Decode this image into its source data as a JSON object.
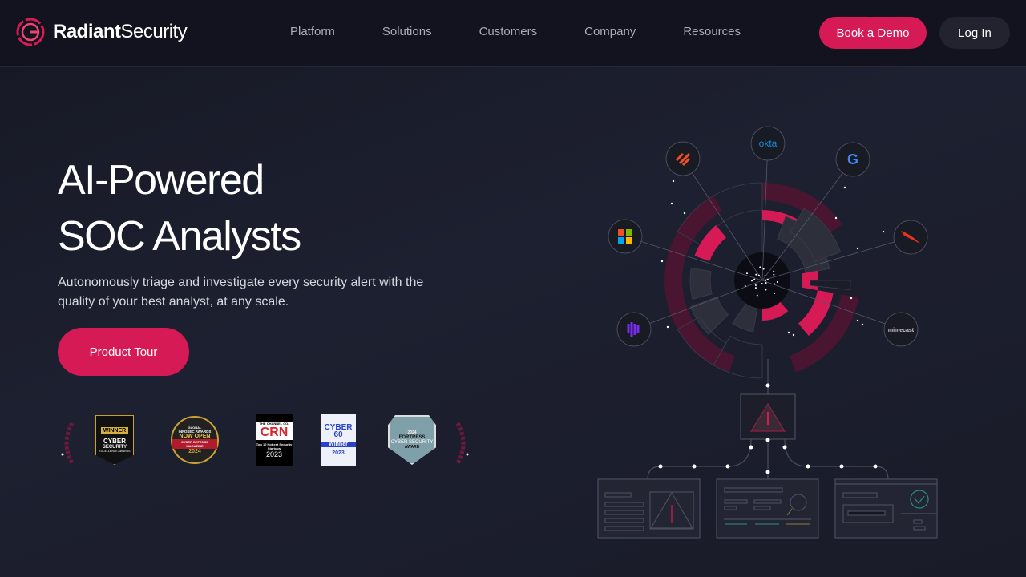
{
  "header": {
    "logo_bold": "Radiant",
    "logo_light": "Security",
    "nav": [
      "Platform",
      "Solutions",
      "Customers",
      "Company",
      "Resources"
    ],
    "book_demo": "Book a Demo",
    "login": "Log In"
  },
  "hero": {
    "title_line1": "AI-Powered",
    "title_line2": "SOC Analysts",
    "subtitle": "Autonomously triage and investigate every security alert with the quality of your best analyst, at any scale.",
    "cta": "Product Tour"
  },
  "awards": [
    {
      "name": "Cyber Security Excellence Awards",
      "lines": [
        "WINNER",
        "CYBER",
        "SECURITY",
        "EXCELLENCE AWARDS"
      ]
    },
    {
      "name": "Global InfoSec Awards",
      "lines": [
        "GLOBAL",
        "INFOSEC AWARDS",
        "NOW OPEN",
        "CYBER DEFENSE MAGAZINE",
        "2024"
      ]
    },
    {
      "name": "CRN",
      "lines": [
        "THE CHANNEL CO.",
        "CRN",
        "Top 10 Hottest Security Startups",
        "2023"
      ]
    },
    {
      "name": "Cyber 60",
      "lines": [
        "CYBER",
        "60",
        "Winner",
        "2023"
      ]
    },
    {
      "name": "Fortress Cyber Security Award",
      "lines": [
        "2024",
        "FORTRESS",
        "CYBER SECURITY",
        "AWARD"
      ]
    }
  ],
  "integrations": [
    "okta",
    "google",
    "crowdstrike",
    "mimecast",
    "purple-logo",
    "microsoft",
    "palo-alto"
  ],
  "integration_labels": {
    "okta": "okta",
    "mimecast": "mimecast"
  },
  "colors": {
    "accent": "#d61a55",
    "background": "#181a26"
  }
}
